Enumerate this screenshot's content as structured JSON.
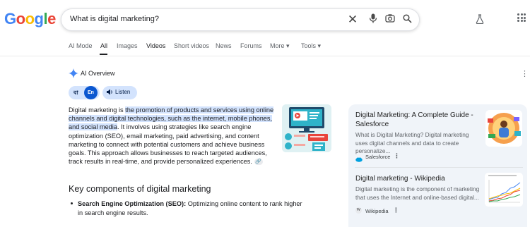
{
  "header": {
    "logo": "Google",
    "search_query": "What is digital marketing?"
  },
  "tabs": [
    {
      "label": "AI Mode",
      "active": false
    },
    {
      "label": "All",
      "active": true
    },
    {
      "label": "Images",
      "active": false
    },
    {
      "label": "Videos",
      "active": false
    },
    {
      "label": "Short videos",
      "active": false
    },
    {
      "label": "News",
      "active": false
    },
    {
      "label": "Forums",
      "active": false
    },
    {
      "label": "More ▾",
      "active": false
    },
    {
      "label": "Tools ▾",
      "active": false
    }
  ],
  "ai_overview": {
    "title": "AI Overview",
    "lang_bn": "বা",
    "lang_en": "En",
    "listen_label": "Listen",
    "answer": {
      "part1": "Digital marketing is ",
      "highlight": "the promotion of products and services using online channels and digital technologies, such as the internet, mobile phones, and social media",
      "part2": ". It involves using strategies like search engine optimization (SEO), email marketing, paid advertising, and content marketing to connect with potential customers and achieve business goals. This approach allows businesses to reach targeted audiences, track results in real-time, and provide personalized experiences."
    },
    "key_heading": "Key components of digital marketing",
    "bullets": [
      {
        "term": "Search Engine Optimization (SEO):",
        "text": " Optimizing online content to rank higher in search engine results."
      }
    ]
  },
  "sources": [
    {
      "title": "Digital Marketing: A Complete Guide - Salesforce",
      "snippet": "What is Digital Marketing? Digital marketing uses digital channels and data to create personalize...",
      "source": "Salesforce"
    },
    {
      "title": "Digital marketing - Wikipedia",
      "snippet": "Digital marketing is the component of marketing that uses the Internet and online-based digital...",
      "source": "Wikipedia"
    }
  ],
  "colors": {
    "google_blue": "#4285f4",
    "google_red": "#ea4335",
    "google_yellow": "#fbbc05",
    "google_green": "#34a853",
    "highlight": "#d3e3fd",
    "panel_bg": "#f0f4f9"
  }
}
